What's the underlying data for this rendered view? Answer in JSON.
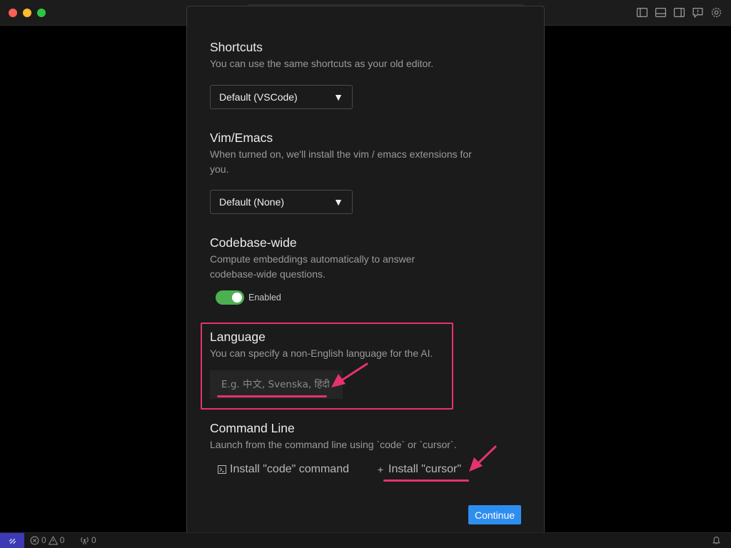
{
  "window": {
    "controls": [
      "close",
      "minimize",
      "zoom"
    ],
    "titlebar_icons": [
      "toggle-primary-sidebar-icon",
      "toggle-panel-icon",
      "toggle-secondary-sidebar-icon",
      "feedback-icon",
      "gear-icon"
    ]
  },
  "onboarding": {
    "shortcuts": {
      "title": "Shortcuts",
      "description": "You can use the same shortcuts as your old editor.",
      "selected": "Default (VSCode)"
    },
    "vim_emacs": {
      "title": "Vim/Emacs",
      "description": "When turned on, we'll install the vim / emacs extensions for you.",
      "selected": "Default (None)"
    },
    "codebase_wide": {
      "title": "Codebase-wide",
      "description": "Compute embeddings automatically to answer codebase-wide questions.",
      "toggle_label": "Enabled",
      "enabled": true
    },
    "language": {
      "title": "Language",
      "description": "You can specify a non-English language for the AI.",
      "input_value": "",
      "input_placeholder": "E.g. 中文, Svenska, हिंदी"
    },
    "command_line": {
      "title": "Command Line",
      "description": "Launch from the command line using `code` or `cursor`.",
      "install_code_label": "Install \"code\" command",
      "install_cursor_label": "Install \"cursor\""
    },
    "continue_label": "Continue"
  },
  "statusbar": {
    "errors": "0",
    "warnings": "0",
    "ports": "0"
  },
  "colors": {
    "accent": "#2e8ef0",
    "toggle_on": "#4caf50",
    "annotation": "#e6336e",
    "remote": "#3d3ab5"
  }
}
